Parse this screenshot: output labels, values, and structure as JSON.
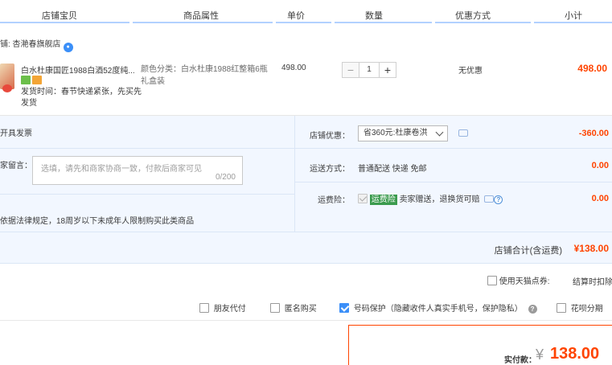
{
  "header": {
    "cols": [
      "店铺宝贝",
      "商品属性",
      "单价",
      "数量",
      "优惠方式",
      "小计"
    ]
  },
  "shop": {
    "label": "铺: 杏滟春旗舰店"
  },
  "item": {
    "title": "白水杜康国匠1988白酒52度纯...",
    "delivery": [
      "发货时间：春节快递紧张，先买先",
      "发货"
    ],
    "attr": "颜色分类：白水杜康1988红整箱6瓶礼盒装",
    "price": "498.00",
    "qty": "1",
    "minus": "−",
    "plus": "+",
    "discount": "无优惠",
    "subtotal": "498.00"
  },
  "service": {
    "invoice": "开具发票",
    "memo_label": "家留言：",
    "memo_placeholder": "选填，请先和商家协商一致，付款后商家可见",
    "memo_count": "0/200",
    "legal": "依据法律规定，18周岁以下未成年人限制购买此类商品",
    "coupon_label": "店铺优惠：",
    "coupon_value": "省360元:杜康卷洪",
    "coupon_amount": "-360.00",
    "ship_label": "运送方式：",
    "ship_value": "普通配送 快递 免邮",
    "ship_amount": "0.00",
    "insure_label": "运费险：",
    "insure_tag": "运费险",
    "insure_text": "卖家赠送，退换货可赔",
    "insure_amount": "0.00"
  },
  "shop_total": {
    "label": "店铺合计(含运费)",
    "amount": "¥138.00"
  },
  "options": {
    "tmall_points": "使用天猫点券:",
    "settle": "结算时扣除",
    "friend_pay": "朋友代付",
    "anon": "匿名购买",
    "protect": "号码保护（隐藏收件人真实手机号，保护隐私）",
    "huabei": "花呗分期"
  },
  "pay": {
    "label": "实付款：",
    "currency": "¥",
    "amount": "138.00"
  }
}
